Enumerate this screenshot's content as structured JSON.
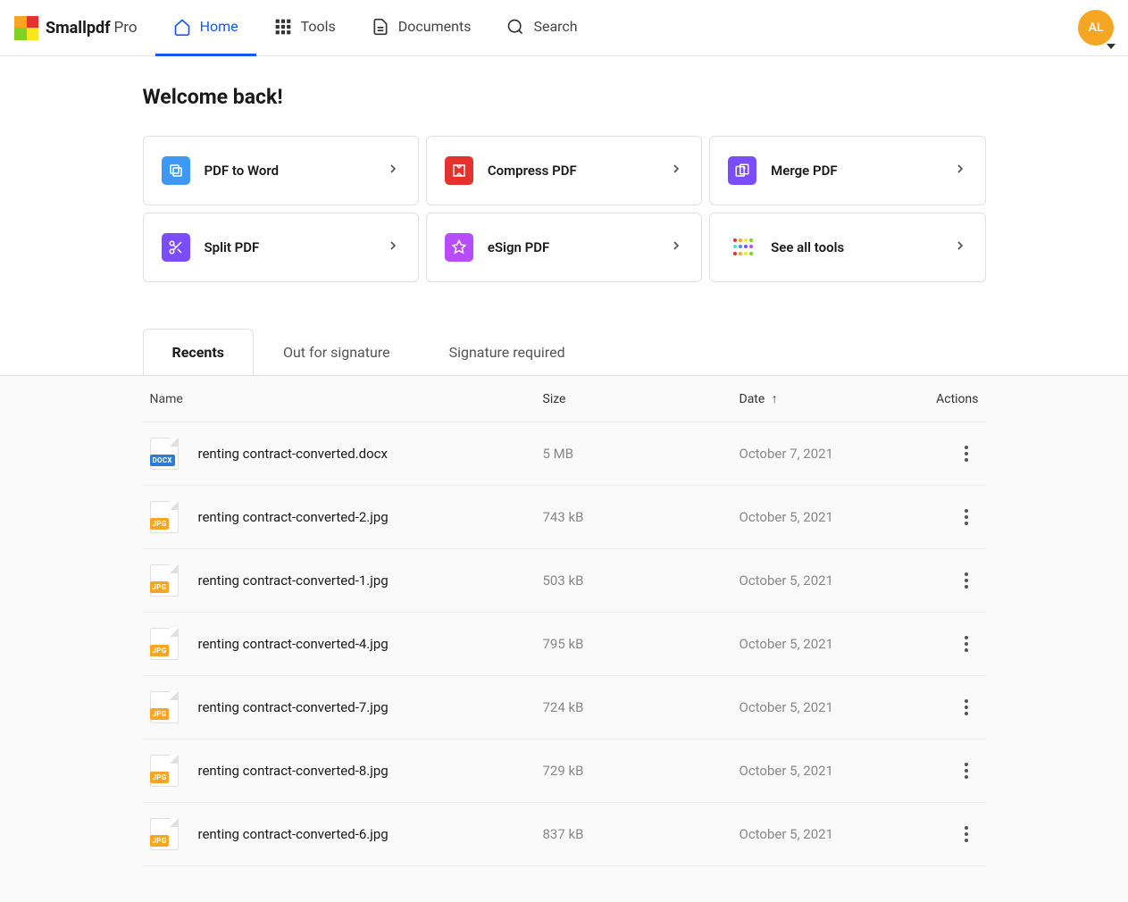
{
  "brand": {
    "name": "Smallpdf",
    "suffix": "Pro"
  },
  "nav": {
    "home": "Home",
    "tools": "Tools",
    "documents": "Documents",
    "search": "Search"
  },
  "avatar": {
    "initials": "AL"
  },
  "welcome": {
    "title": "Welcome back!"
  },
  "tools": [
    {
      "label": "PDF to Word",
      "icon": "pdf-to-word",
      "color": "#3d99f5"
    },
    {
      "label": "Compress PDF",
      "icon": "compress",
      "color": "#e5322d"
    },
    {
      "label": "Merge PDF",
      "icon": "merge",
      "color": "#7c4dff"
    },
    {
      "label": "Split PDF",
      "icon": "split",
      "color": "#7c4dff"
    },
    {
      "label": "eSign PDF",
      "icon": "esign",
      "color": "#b84dff"
    },
    {
      "label": "See all tools",
      "icon": "all",
      "color": "multi"
    }
  ],
  "tabs": {
    "recents": "Recents",
    "out_for_signature": "Out for signature",
    "signature_required": "Signature required"
  },
  "table": {
    "headers": {
      "name": "Name",
      "size": "Size",
      "date": "Date",
      "actions": "Actions"
    },
    "sort_arrow": "↑",
    "rows": [
      {
        "name": "renting contract-converted.docx",
        "size": "5 MB",
        "date": "October 7, 2021",
        "type": "docx",
        "badge": "DOCX"
      },
      {
        "name": "renting contract-converted-2.jpg",
        "size": "743 kB",
        "date": "October 5, 2021",
        "type": "jpg",
        "badge": "JPG"
      },
      {
        "name": "renting contract-converted-1.jpg",
        "size": "503 kB",
        "date": "October 5, 2021",
        "type": "jpg",
        "badge": "JPG"
      },
      {
        "name": "renting contract-converted-4.jpg",
        "size": "795 kB",
        "date": "October 5, 2021",
        "type": "jpg",
        "badge": "JPG"
      },
      {
        "name": "renting contract-converted-7.jpg",
        "size": "724 kB",
        "date": "October 5, 2021",
        "type": "jpg",
        "badge": "JPG"
      },
      {
        "name": "renting contract-converted-8.jpg",
        "size": "729 kB",
        "date": "October 5, 2021",
        "type": "jpg",
        "badge": "JPG"
      },
      {
        "name": "renting contract-converted-6.jpg",
        "size": "837 kB",
        "date": "October 5, 2021",
        "type": "jpg",
        "badge": "JPG"
      }
    ]
  }
}
